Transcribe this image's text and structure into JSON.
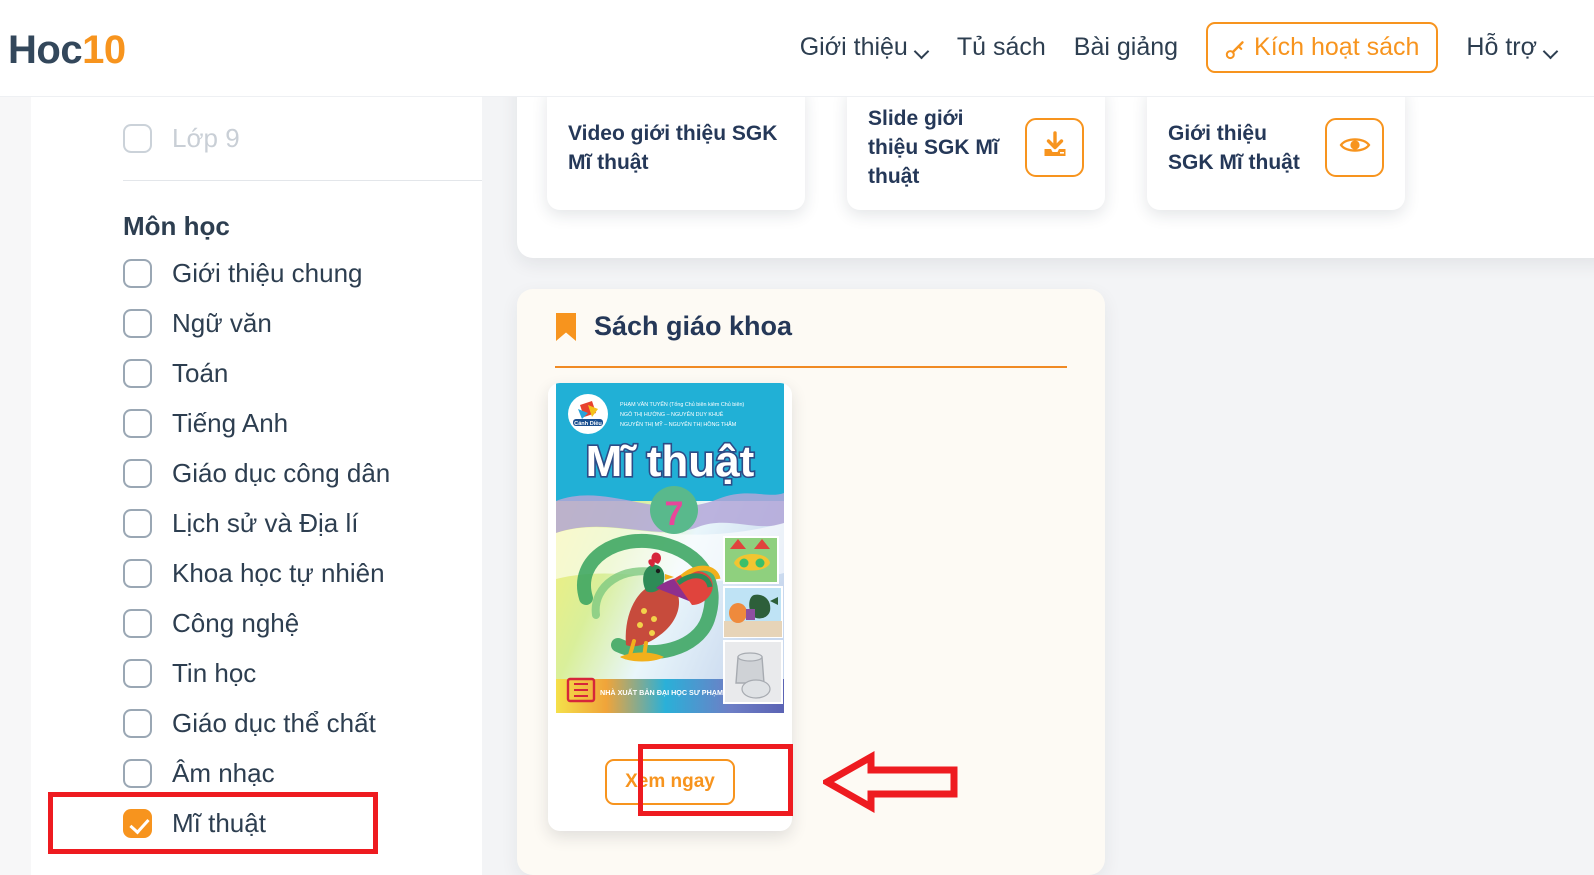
{
  "brand": {
    "name_dark": "Hoc",
    "name_accent": "10",
    "accent_color": "#f7941e",
    "dark_color": "#33475b"
  },
  "nav": {
    "items": [
      {
        "label": "Giới thiệu",
        "has_caret": true
      },
      {
        "label": "Tủ sách",
        "has_caret": false
      },
      {
        "label": "Bài giảng",
        "has_caret": false
      }
    ],
    "activate_button": {
      "label": "Kích hoạt sách",
      "icon": "key-icon"
    },
    "support": {
      "label": "Hỗ trợ",
      "has_caret": true
    }
  },
  "sidebar": {
    "grade_filter": {
      "label": "Lớp 9",
      "checked": false,
      "disabled": true
    },
    "subject_section_title": "Môn học",
    "subjects": [
      {
        "label": "Giới thiệu chung",
        "checked": false
      },
      {
        "label": "Ngữ văn",
        "checked": false
      },
      {
        "label": "Toán",
        "checked": false
      },
      {
        "label": "Tiếng Anh",
        "checked": false
      },
      {
        "label": "Giáo dục công dân",
        "checked": false
      },
      {
        "label": "Lịch sử và Địa lí",
        "checked": false
      },
      {
        "label": "Khoa học tự nhiên",
        "checked": false
      },
      {
        "label": "Công nghệ",
        "checked": false
      },
      {
        "label": "Tin học",
        "checked": false
      },
      {
        "label": "Giáo dục thể chất",
        "checked": false
      },
      {
        "label": "Âm nhạc",
        "checked": false
      },
      {
        "label": "Mĩ thuật",
        "checked": true
      }
    ]
  },
  "resources": {
    "cards": [
      {
        "title": "Video giới thiệu SGK Mĩ thuật",
        "icon": null
      },
      {
        "title": "Slide giới thiệu SGK Mĩ thuật",
        "icon": "download-icon"
      },
      {
        "title": "Giới thiệu SGK Mĩ thuật",
        "icon": "eye-icon"
      }
    ]
  },
  "textbook_section": {
    "title": "Sách giáo khoa",
    "icon": "bookmark-icon",
    "book": {
      "cover": {
        "publisher_logo_text": "Cánh Diều",
        "authors": [
          "PHẠM VĂN TUYẾN (Tổng Chủ biên kiêm Chủ biên)",
          "NGÔ THỊ HƯỜNG – NGUYỄN DUY KHUÊ",
          "NGUYỄN THỊ MỸ – NGUYỄN THỊ HỒNG THẮM"
        ],
        "title": "Mĩ thuật",
        "grade": "7",
        "publisher": "NHÀ XUẤT BẢN ĐẠI HỌC SƯ PHẠM"
      },
      "action_label": "Xem ngay"
    }
  },
  "annotations": {
    "highlight_color": "#ee1b20",
    "boxes": [
      "sidebar-subject-mi-thuat",
      "xem-ngay-button"
    ],
    "arrow": {
      "direction": "left",
      "points_to": "xem-ngay-button"
    }
  }
}
